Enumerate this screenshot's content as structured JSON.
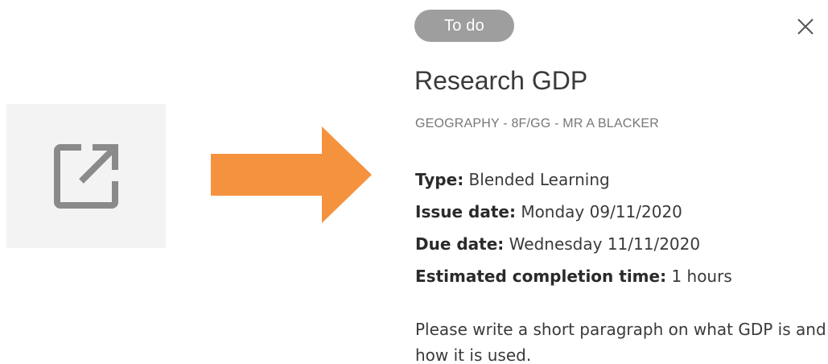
{
  "icons": {
    "open_external": "open-in-new-icon",
    "arrow": "arrow-right-icon",
    "close": "close-icon"
  },
  "colors": {
    "arrow": "#f5923e",
    "badge": "#9e9e9e",
    "icon": "#8a8a8a",
    "tile": "#f3f3f3"
  },
  "task": {
    "status": "To do",
    "title": "Research GDP",
    "subtitle": "GEOGRAPHY - 8F/GG - MR A BLACKER",
    "details": [
      {
        "label": "Type:",
        "value": "Blended Learning"
      },
      {
        "label": "Issue date:",
        "value": "Monday 09/11/2020"
      },
      {
        "label": "Due date:",
        "value": "Wednesday 11/11/2020"
      },
      {
        "label": "Estimated completion time:",
        "value": "1 hours"
      }
    ],
    "description": "Please write a short paragraph on what GDP is and how it is used."
  }
}
